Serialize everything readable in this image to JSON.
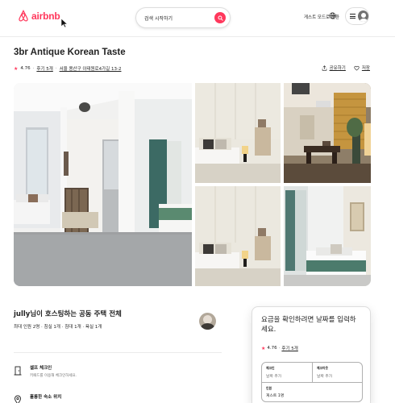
{
  "colors": {
    "brand": "#ff385c",
    "text": "#222222",
    "muted": "#717171",
    "border": "#dddddd"
  },
  "header": {
    "logo_text": "airbnb",
    "search_placeholder": "검색 시작하기",
    "host_link": "게스트 모드로 전환",
    "globe_icon": "globe-icon",
    "menu_icon": "hamburger-icon",
    "avatar_icon": "user-avatar-icon"
  },
  "listing": {
    "title": "3br Antique Korean Taste",
    "rating": "4.76",
    "reviews": "후기 5개",
    "location": "서울 용산구 이태원로4가길 13-2",
    "share_label": "공유하기",
    "save_label": "저장"
  },
  "host": {
    "title": "jully님이 호스팅하는 공동 주택 전체",
    "details": "최대 인원 2명 · 침실 1개 · 침대 1개 · 욕실 1개"
  },
  "features": [
    {
      "icon": "door-icon",
      "title": "셀프 체크인",
      "desc": "키패드를 이용해 체크인하세요."
    },
    {
      "icon": "location-pin-icon",
      "title": "훌륭한 숙소 위치",
      "desc": ""
    }
  ],
  "booking": {
    "prompt": "요금을 확인하려면 날짜를 입력하세요.",
    "rating": "4.76",
    "reviews": "후기 5개",
    "checkin_label": "체크인",
    "checkin_value": "날짜 추가",
    "checkout_label": "체크아웃",
    "checkout_value": "날짜 추가",
    "guests_label": "인원",
    "guests_value": "게스트 1명"
  }
}
